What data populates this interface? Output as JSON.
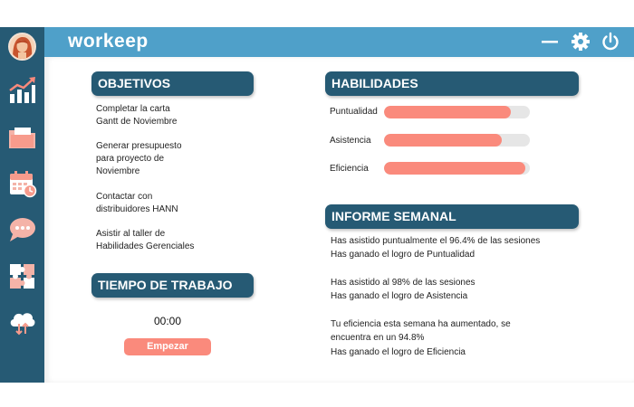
{
  "app": {
    "logo_text": "workeep"
  },
  "topbar": {
    "icons": [
      "minimize-icon",
      "gear-icon",
      "power-icon"
    ]
  },
  "sidebar": {
    "items": [
      {
        "icon": "chart-icon"
      },
      {
        "icon": "folder-icon"
      },
      {
        "icon": "calendar-clock-icon"
      },
      {
        "icon": "chat-icon"
      },
      {
        "icon": "puzzle-icon"
      },
      {
        "icon": "cloud-icon"
      }
    ]
  },
  "objetivos": {
    "title": "OBJETIVOS",
    "tasks": [
      {
        "line1": "Completar la carta",
        "line2": "Gantt de Noviembre",
        "line3": ""
      },
      {
        "line1": "Generar presupuesto",
        "line2": "para proyecto de",
        "line3": "Noviembre"
      },
      {
        "line1": "Contactar con",
        "line2": "distribuidores HANN",
        "line3": ""
      },
      {
        "line1": "Asistir al taller de",
        "line2": "Habilidades Gerenciales",
        "line3": ""
      }
    ]
  },
  "tiempo": {
    "title": "TIEMPO DE TRABAJO",
    "timer": "00:00",
    "start_label": "Empezar"
  },
  "habilidades": {
    "title": "HABILIDADES",
    "skills": [
      {
        "label": "Puntualidad",
        "level": 0.87
      },
      {
        "label": "Asistencia",
        "level": 0.81
      },
      {
        "label": "Eficiencia",
        "level": 0.97
      }
    ]
  },
  "informe": {
    "title": "INFORME SEMANAL",
    "lines": [
      "Has asistido puntualmente el 96.4% de las sesiones",
      "Has ganado el logro de Puntualidad",
      "Has asistido al 98% de las sesiones",
      "Has ganado el logro de Asistencia",
      "Tu eficiencia esta semana ha aumentado, se",
      "encuentra en un 94.8%",
      "Has ganado el logro de Eficiencia"
    ]
  },
  "colors": {
    "sidebar": "#265a74",
    "topbar": "#4fa0c9",
    "accent": "#fa8a7c",
    "header": "#265a74"
  }
}
